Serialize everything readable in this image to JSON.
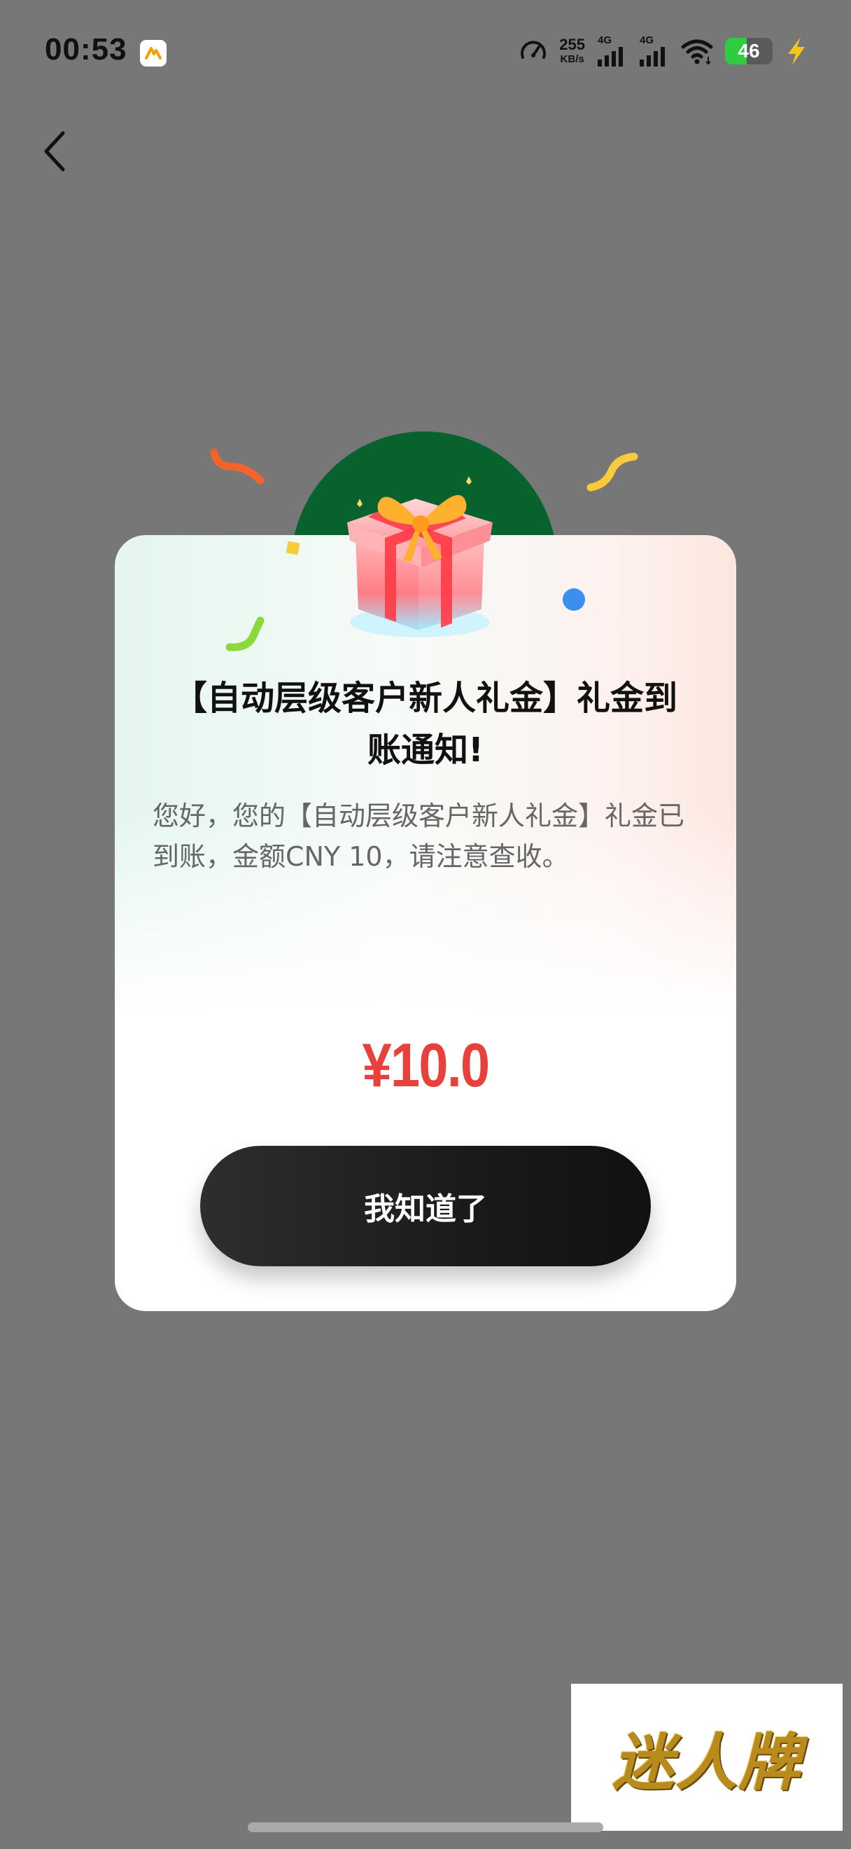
{
  "status_bar": {
    "time": "00:53",
    "net_speed_value": "255",
    "net_speed_unit": "KB/s",
    "sim1_label": "4G",
    "sim2_label": "4G",
    "battery_level": "46",
    "battery_fraction": 0.46,
    "icons": [
      "app-notification-icon",
      "speed-gauge-icon",
      "signal-icon",
      "signal-icon",
      "wifi-icon",
      "battery-icon",
      "charging-bolt-icon"
    ]
  },
  "nav": {
    "back_icon": "chevron-left-icon"
  },
  "dialog": {
    "title": "【自动层级客户新人礼金】礼金到账通知!",
    "message": "您好，您的【自动层级客户新人礼金】礼金已到账，金额CNY 10，请注意查收。",
    "amount": "¥10.0",
    "confirm_label": "我知道了",
    "gift_icon": "gift-box-icon"
  },
  "watermark": {
    "text": "迷人牌"
  },
  "colors": {
    "backdrop": "#777777",
    "amount": "#e8403a",
    "button": "#1a1a1a",
    "gift_circle": "#08622e",
    "battery_fill": "#2ecc40",
    "bolt": "#f5c518"
  }
}
